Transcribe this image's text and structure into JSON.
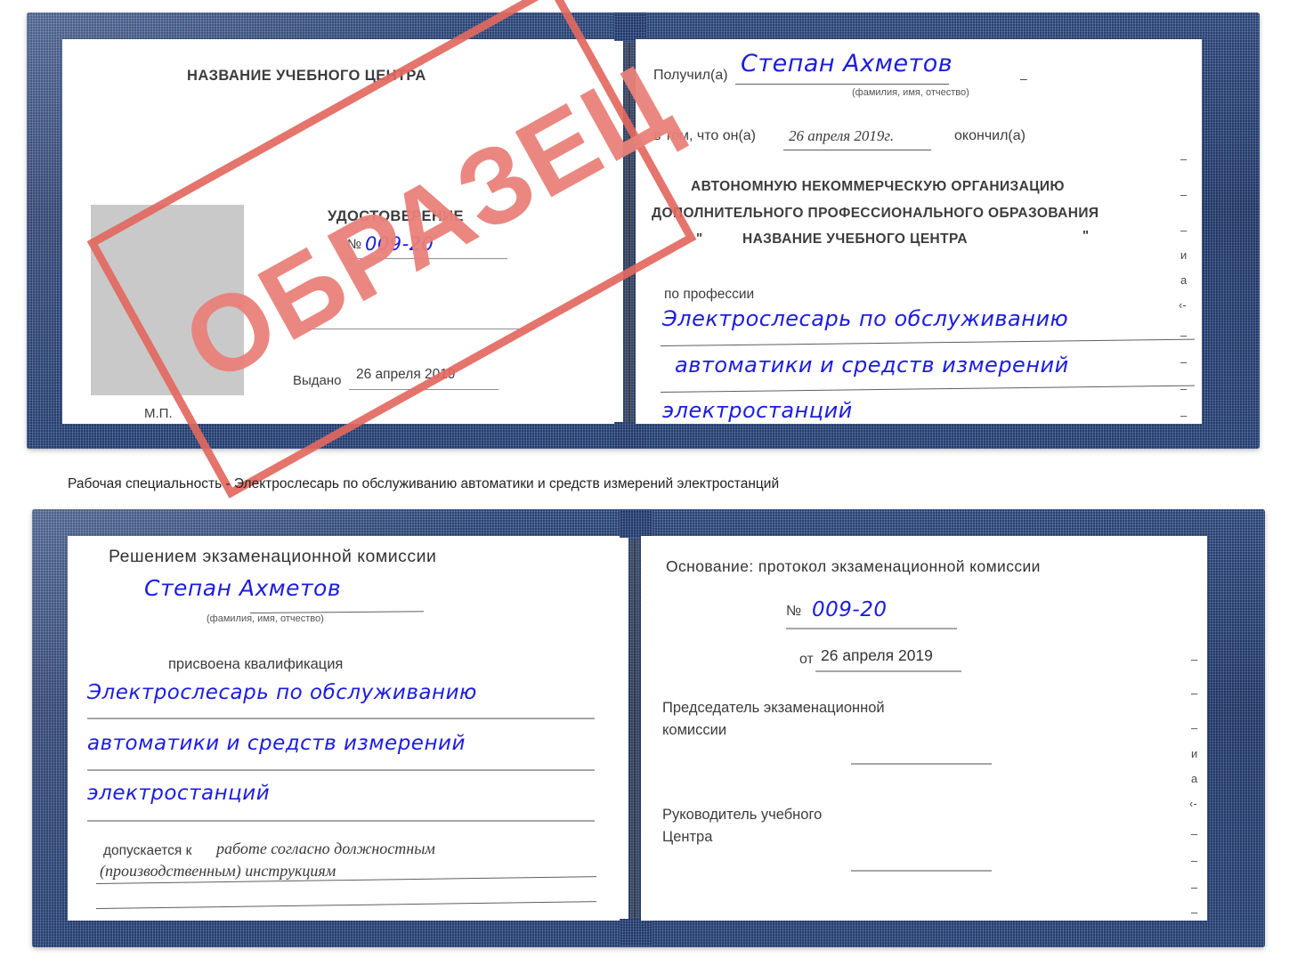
{
  "document1": {
    "left_page": {
      "org_title": "НАЗВАНИЕ УЧЕБНОГО ЦЕНТРА",
      "doc_type": "УДОСТОВЕРЕНИЕ",
      "number_label": "№",
      "number_value": "009-20",
      "issued_label": "Выдано",
      "issued_value": "26 апреля 2019",
      "seal_label": "М.П.",
      "photo_placeholder": "photo-area"
    },
    "right_page": {
      "received_label": "Получил(а)",
      "received_value": "Степан Ахметов",
      "fio_hint": "(фамилия, имя, отчество)",
      "that_he_label": "в том, что он(а)",
      "that_he_value": "26 апреля 2019г.",
      "finished_label": "окончил(а)",
      "org_line1": "АВТОНОМНУЮ НЕКОММЕРЧЕСКУЮ ОРГАНИЗАЦИЮ",
      "org_line2": "ДОПОЛНИТЕЛЬНОГО ПРОФЕССИОНАЛЬНОГО ОБРАЗОВАНИЯ",
      "org_quote_open": "\"",
      "org_line3": "НАЗВАНИЕ УЧЕБНОГО ЦЕНТРА",
      "org_quote_close": "\"",
      "profession_label": "по профессии",
      "profession_line1": "Электрослесарь по обслуживанию",
      "profession_line2": "автоматики и средств измерений",
      "profession_line3": "электростанций",
      "margin_glyphs": [
        "–",
        "–",
        "–",
        "и",
        "а",
        "‹-",
        "–",
        "–",
        "–",
        "–"
      ]
    }
  },
  "caption": "Рабочая специальность - Электрослесарь по обслуживанию автоматики и средств измерений электростанций",
  "document2": {
    "left_page": {
      "heading": "Решением экзаменационной комиссии",
      "name_value": "Степан Ахметов",
      "fio_hint": "(фамилия, имя, отчество)",
      "qualification_label": "присвоена квалификация",
      "qualification_line1": "Электрослесарь по обслуживанию",
      "qualification_line2": "автоматики и средств измерений",
      "qualification_line3": "электростанций",
      "allowed_label": "допускается к",
      "allowed_value_line1": "работе согласно должностным",
      "allowed_value_line2": "(производственным) инструкциям"
    },
    "right_page": {
      "basis_label": "Основание: протокол экзаменационной комиссии",
      "number_label": "№",
      "number_value": "009-20",
      "date_label": "от",
      "date_value": "26 апреля 2019",
      "chairman_line1": "Председатель экзаменационной",
      "chairman_line2": "комиссии",
      "head_line1": "Руководитель учебного",
      "head_line2": "Центра",
      "margin_glyphs": [
        "–",
        "–",
        "–",
        "и",
        "а",
        "‹-",
        "–",
        "–",
        "–",
        "–"
      ]
    }
  },
  "stamp": {
    "text": "ОБРАЗЕЦ",
    "color": "#e2685f"
  },
  "colors": {
    "cover_blue": "#2c4a86",
    "handwriting_blue": "#1c1ce0",
    "stamp_red": "#e2685f",
    "photo_gray": "#c9c9c9",
    "rule_gray": "#8e8e8e"
  }
}
